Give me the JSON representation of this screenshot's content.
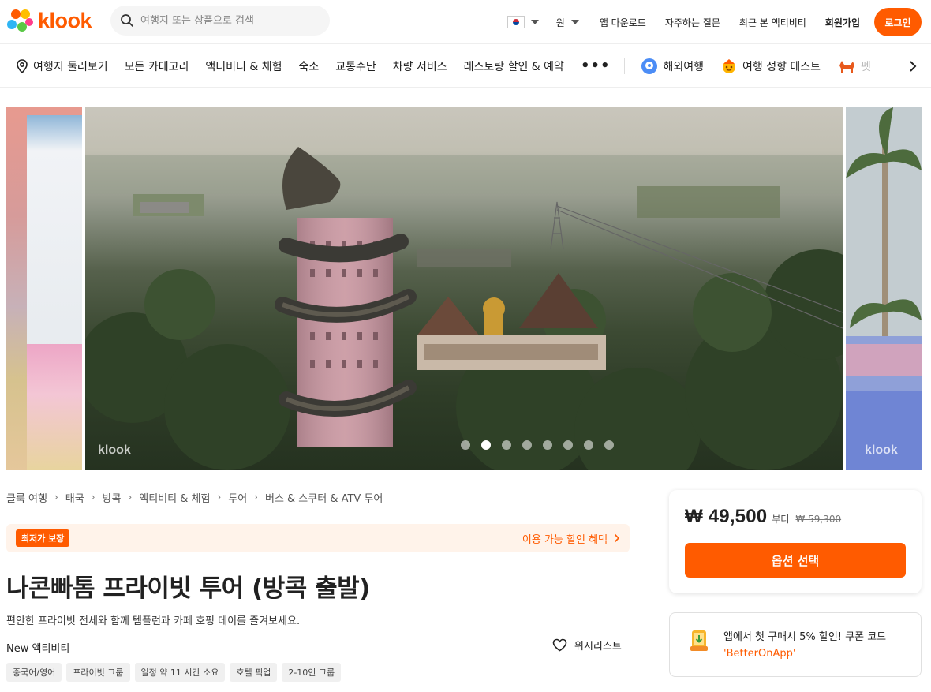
{
  "brand": {
    "name": "klook",
    "color": "#ff5b00"
  },
  "header": {
    "search_placeholder": "여행지 또는 상품으로 검색",
    "currency": "원",
    "links": [
      "앱 다운로드",
      "자주하는 질문",
      "최근 본 액티비티"
    ],
    "signup": "회원가입",
    "login": "로그인"
  },
  "categories": {
    "items": [
      "여행지 둘러보기",
      "모든 카테고리",
      "액티비티 & 체험",
      "숙소",
      "교통수단",
      "차량 서비스",
      "레스토랑 할인 & 예약"
    ],
    "more": "•••",
    "extra": [
      "해외여행",
      "여행 성향 테스트"
    ],
    "truncated": "펫"
  },
  "gallery": {
    "watermark": "klook",
    "slide_count": 8,
    "active_index": 1
  },
  "breadcrumb": [
    "클룩 여행",
    "태국",
    "방콕",
    "액티비티 & 체험",
    "투어",
    "버스 & 스쿠터 & ATV 투어"
  ],
  "promo": {
    "badge": "최저가 보장",
    "link": "이용 가능 할인 혜택"
  },
  "product": {
    "title": "나콘빠톰 프라이빗 투어 (방콕 출발)",
    "subtitle": "편안한 프라이빗 전세와 함께 템플런과 카페 호핑 데이를 즐겨보세요.",
    "status": "New 액티비티",
    "wishlist": "위시리스트",
    "tags": [
      "중국어/영어",
      "프라이빗 그룹",
      "일정 약 11 시간 소요",
      "호텔 픽업",
      "2-10인 그룹"
    ]
  },
  "price": {
    "current": "₩ 49,500",
    "from": "부터",
    "original": "₩ 59,300",
    "button": "옵션 선택"
  },
  "app_promo": {
    "text": "앱에서 첫 구매시 5% 할인! 쿠폰 코드",
    "code": "'BetterOnApp'"
  }
}
